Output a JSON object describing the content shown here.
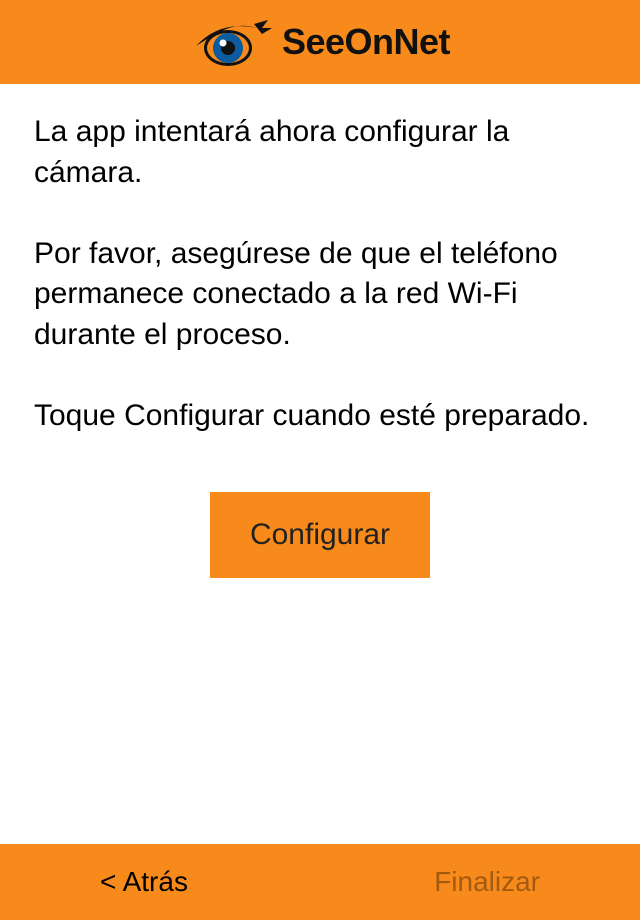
{
  "brand": {
    "name": "SeeOnNet"
  },
  "colors": {
    "accent": "#f78a1a"
  },
  "content": {
    "instructions": "La app intentará ahora configurar la cámara.\n\nPor favor, asegúrese de que el teléfono permanece conectado a la red Wi-Fi durante el proceso.\n\nToque Configurar cuando esté preparado.",
    "configure_label": "Configurar"
  },
  "footer": {
    "back_label": "< Atrás",
    "finish_label": "Finalizar"
  }
}
